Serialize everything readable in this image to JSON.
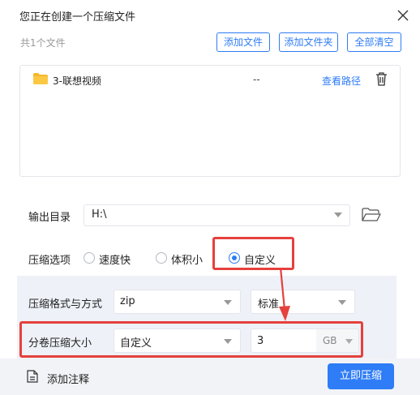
{
  "dialog": {
    "title": "您正在创建一个压缩文件"
  },
  "toolbar": {
    "file_count": "共1个文件",
    "add_file_label": "添加文件",
    "add_folder_label": "添加文件夹",
    "clear_all_label": "全部清空"
  },
  "file_list": {
    "rows": [
      {
        "name": "3-联想视频",
        "size": "--",
        "view_path_label": "查看路径",
        "icon": "folder-icon"
      }
    ]
  },
  "output": {
    "label": "输出目录",
    "value": "H:\\"
  },
  "compress_options": {
    "label": "压缩选项",
    "options": [
      "速度快",
      "体积小",
      "自定义"
    ],
    "selected": "自定义"
  },
  "format": {
    "label": "压缩格式与方式",
    "format_value": "zip",
    "level_value": "标准"
  },
  "split": {
    "label": "分卷压缩大小",
    "mode_value": "自定义",
    "size_value": "3",
    "unit_value": "GB"
  },
  "footer": {
    "add_note_label": "添加注释",
    "compress_label": "立即压缩"
  },
  "colors": {
    "accent": "#2e7cf6",
    "highlight": "#e5413d",
    "folder": "#f5b82e"
  }
}
